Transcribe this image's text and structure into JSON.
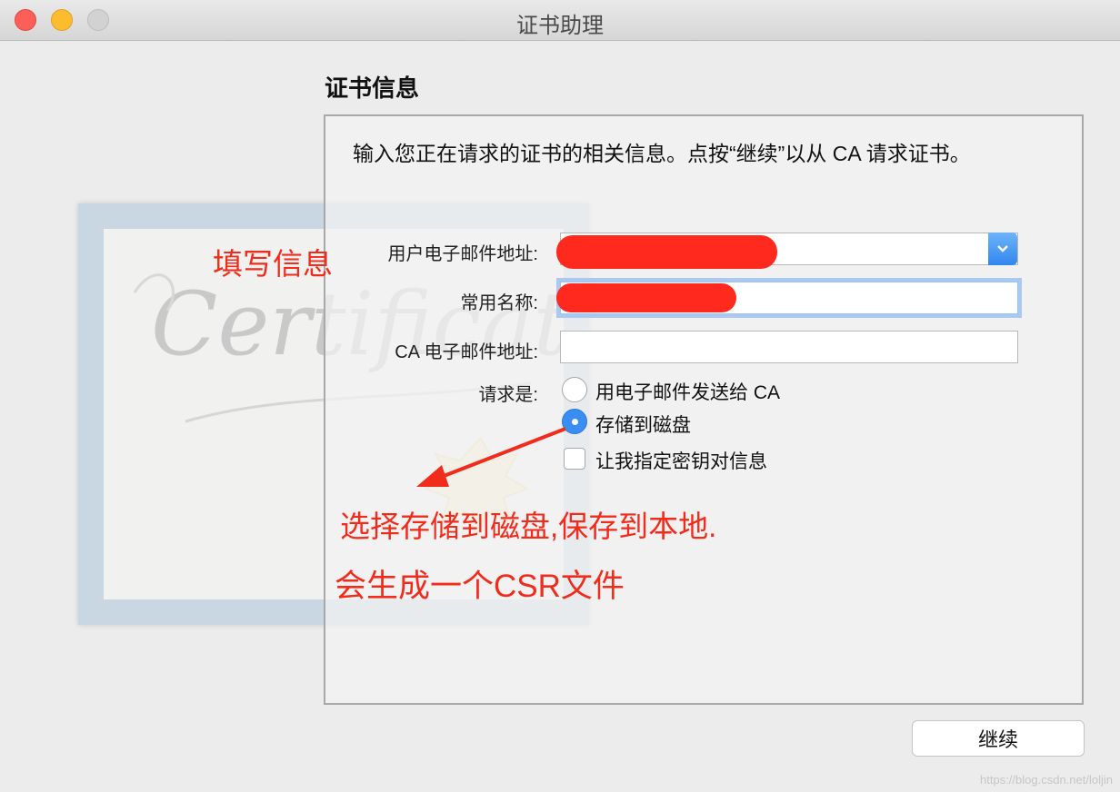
{
  "window": {
    "title": "证书助理"
  },
  "section_title": "证书信息",
  "description": "输入您正在请求的证书的相关信息。点按“继续”以从 CA 请求证书。",
  "certificate_art_text": "Certificate",
  "form": {
    "email_label": "用户电子邮件地址:",
    "email_value": "",
    "common_name_label": "常用名称:",
    "common_name_value": "",
    "ca_email_label": "CA 电子邮件地址:",
    "ca_email_value": "",
    "request_label": "请求是:",
    "options": [
      {
        "label": "用电子邮件发送给 CA",
        "selected": false
      },
      {
        "label": "存储到磁盘",
        "selected": true
      }
    ],
    "checkbox_label": "让我指定密钥对信息",
    "checkbox_checked": false
  },
  "annotations": {
    "fill_info": "填写信息",
    "save_to_disk": "选择存储到磁盘,保存到本地.",
    "csr_note": "会生成一个CSR文件"
  },
  "buttons": {
    "continue": "继续"
  },
  "watermark": "https://blog.csdn.net/loljin",
  "colors": {
    "annotation_red": "#f22c1c",
    "accent_blue": "#3a8ef1"
  }
}
